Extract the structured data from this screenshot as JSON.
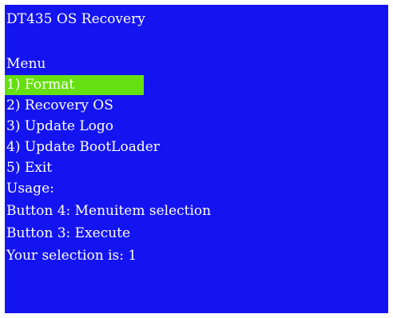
{
  "colors": {
    "screen_background": "#1414f0",
    "text": "#ffffff",
    "selected_highlight": "#66e010"
  },
  "title": "DT435 OS Recovery",
  "menu": {
    "heading": "Menu",
    "items": [
      {
        "label": "1) Format",
        "selected": true
      },
      {
        "label": "2) Recovery OS",
        "selected": false
      },
      {
        "label": "3) Update Logo",
        "selected": false
      },
      {
        "label": "4) Update BootLoader",
        "selected": false
      },
      {
        "label": "5) Exit",
        "selected": false
      }
    ]
  },
  "usage": {
    "heading": "Usage:",
    "lines": [
      "Button 4: Menuitem selection",
      "Button 3: Execute"
    ]
  },
  "selection_status": "Your selection is: 1"
}
